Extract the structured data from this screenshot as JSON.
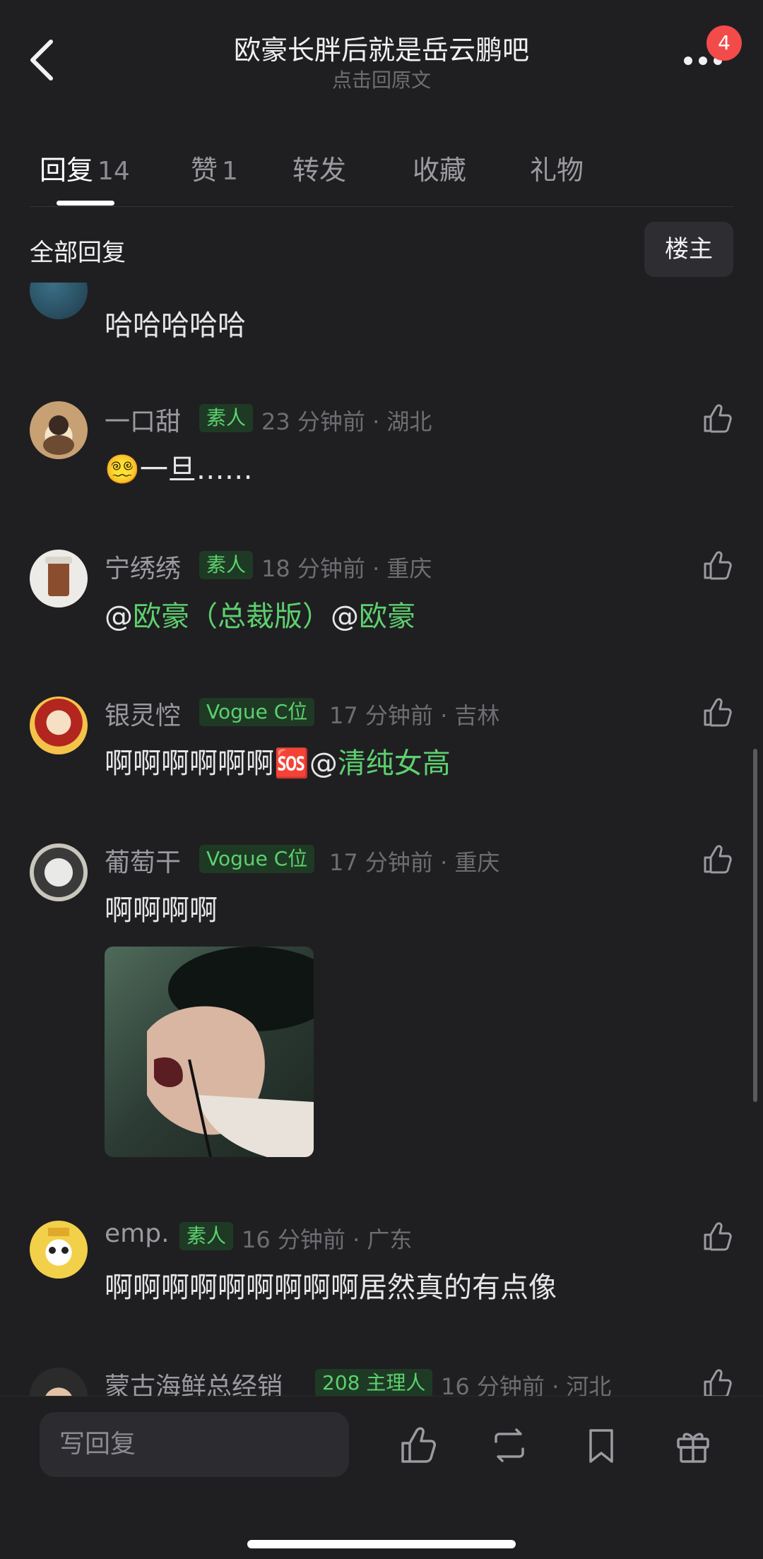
{
  "header": {
    "title": "欧豪长胖后就是岳云鹏吧",
    "subtitle": "点击回原文",
    "notification_count": "4"
  },
  "tabs": [
    {
      "label": "回复",
      "count": "14",
      "active": true
    },
    {
      "label": "赞",
      "count": "1"
    },
    {
      "label": "转发"
    },
    {
      "label": "收藏"
    },
    {
      "label": "礼物"
    }
  ],
  "section": {
    "title": "全部回复",
    "owner_button": "楼主"
  },
  "comments": [
    {
      "text": "哈哈哈哈哈"
    },
    {
      "name": "一口甜",
      "badge": "素人",
      "meta": "23 分钟前 · 湖北",
      "emoji": "😵‍💫",
      "text": "一旦……"
    },
    {
      "name": "宁绣绣",
      "badge": "素人",
      "meta": "18 分钟前 · 重庆",
      "parts": [
        "@",
        "欧豪（总裁版）",
        "@",
        "欧豪"
      ]
    },
    {
      "name": "银灵悾",
      "badge": "Vogue C位",
      "meta": "17 分钟前 · 吉林",
      "text": "啊啊啊啊啊啊",
      "emoji": "🆘",
      "at": "@",
      "mention": "清纯女高"
    },
    {
      "name": "葡萄干",
      "badge": "Vogue C位",
      "meta": "17 分钟前 · 重庆",
      "text": "啊啊啊啊"
    },
    {
      "name": "emp.",
      "badge": "素人",
      "meta": "16 分钟前 · 广东",
      "text": "啊啊啊啊啊啊啊啊啊居然真的有点像"
    },
    {
      "name": "蒙古海鲜总经销",
      "badge": "208 主理人",
      "meta": "16 分钟前 · 河北"
    }
  ],
  "bottom": {
    "reply_placeholder": "写回复"
  },
  "colors": {
    "background": "#1f1f21",
    "accent_green": "#5dd06f",
    "badge_bg": "#1e3a24",
    "notification_red": "#f34a4a"
  },
  "icons": [
    "back-icon",
    "more-icon",
    "thumbs-up-icon",
    "repost-icon",
    "bookmark-icon",
    "gift-icon"
  ]
}
